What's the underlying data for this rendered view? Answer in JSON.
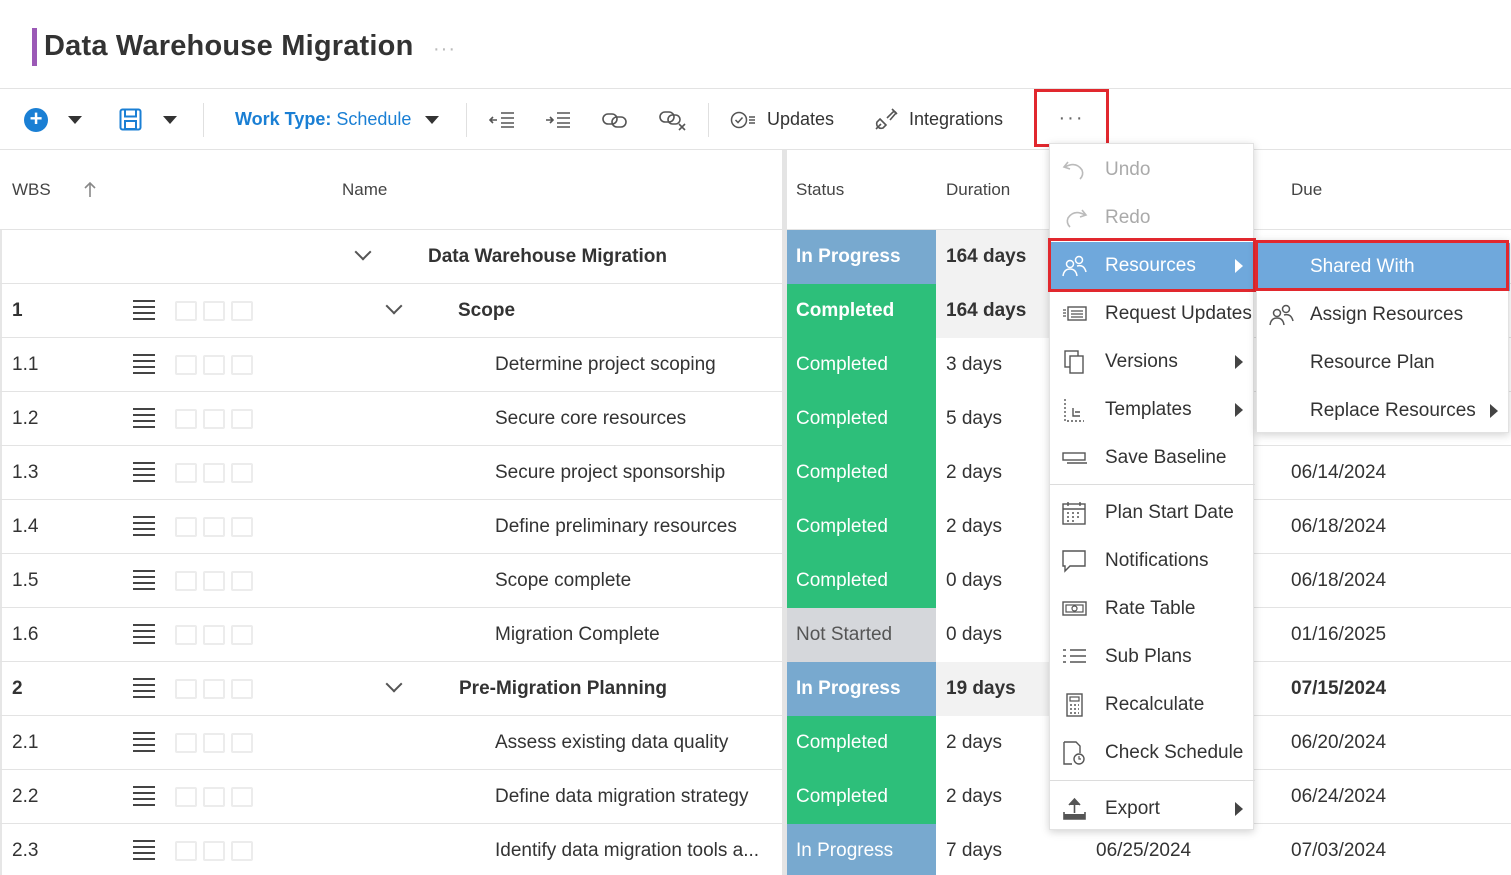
{
  "project": {
    "title": "Data Warehouse Migration",
    "title_more": "···"
  },
  "toolbar": {
    "work_type_label": "Work Type:",
    "work_type_value": "Schedule",
    "updates_label": "Updates",
    "integrations_label": "Integrations",
    "more_label": "···"
  },
  "columns": {
    "wbs": "WBS",
    "name": "Name",
    "status": "Status",
    "duration": "Duration",
    "due": "Due"
  },
  "rows": [
    {
      "wbs": "",
      "name": "Data Warehouse Migration",
      "status": "In Progress",
      "duration": "164 days",
      "start": "",
      "due": ""
    },
    {
      "wbs": "1",
      "name": "Scope",
      "status": "Completed",
      "duration": "164 days",
      "start": "",
      "due": ""
    },
    {
      "wbs": "1.1",
      "name": "Determine project scoping",
      "status": "Completed",
      "duration": "3 days",
      "start": "",
      "due": ""
    },
    {
      "wbs": "1.2",
      "name": "Secure core resources",
      "status": "Completed",
      "duration": "5 days",
      "start": "",
      "due": ""
    },
    {
      "wbs": "1.3",
      "name": "Secure project sponsorship",
      "status": "Completed",
      "duration": "2 days",
      "start": "",
      "due": "06/14/2024"
    },
    {
      "wbs": "1.4",
      "name": "Define preliminary resources",
      "status": "Completed",
      "duration": "2 days",
      "start": "",
      "due": "06/18/2024"
    },
    {
      "wbs": "1.5",
      "name": "Scope complete",
      "status": "Completed",
      "duration": "0 days",
      "start": "",
      "due": "06/18/2024"
    },
    {
      "wbs": "1.6",
      "name": "Migration Complete",
      "status": "Not Started",
      "duration": "0 days",
      "start": "",
      "due": "01/16/2025"
    },
    {
      "wbs": "2",
      "name": "Pre-Migration Planning",
      "status": "In Progress",
      "duration": "19 days",
      "start": "",
      "due": "07/15/2024"
    },
    {
      "wbs": "2.1",
      "name": "Assess existing data quality",
      "status": "Completed",
      "duration": "2 days",
      "start": "",
      "due": "06/20/2024"
    },
    {
      "wbs": "2.2",
      "name": "Define data migration strategy",
      "status": "Completed",
      "duration": "2 days",
      "start": "",
      "due": "06/24/2024"
    },
    {
      "wbs": "2.3",
      "name": "Identify data migration tools a...",
      "status": "In Progress",
      "duration": "7 days",
      "start": "06/25/2024",
      "due": "07/03/2024"
    }
  ],
  "menu": {
    "items": [
      {
        "label": "Undo"
      },
      {
        "label": "Redo"
      },
      {
        "label": "Resources"
      },
      {
        "label": "Request Updates"
      },
      {
        "label": "Versions"
      },
      {
        "label": "Templates"
      },
      {
        "label": "Save Baseline"
      },
      {
        "label": "Plan Start Date"
      },
      {
        "label": "Notifications"
      },
      {
        "label": "Rate Table"
      },
      {
        "label": "Sub Plans"
      },
      {
        "label": "Recalculate"
      },
      {
        "label": "Check Schedule"
      },
      {
        "label": "Export"
      }
    ]
  },
  "submenu": {
    "items": [
      {
        "label": "Shared With"
      },
      {
        "label": "Assign Resources"
      },
      {
        "label": "Resource Plan"
      },
      {
        "label": "Replace Resources"
      }
    ]
  },
  "colors": {
    "accent": "#1a7fd4",
    "title_accent": "#9b59b6",
    "completed": "#2dbf7a",
    "in_progress": "#78a9cf",
    "not_started": "#d5d7db",
    "highlight": "#e1282e",
    "menu_active": "#6fa8dc"
  }
}
